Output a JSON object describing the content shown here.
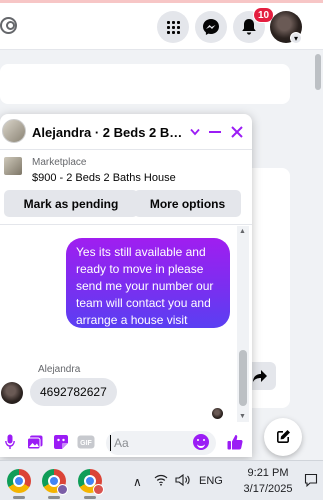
{
  "topbar": {
    "notification_count": "10"
  },
  "chat": {
    "title": "Alejandra · 2 Beds 2 Baths…",
    "marketplace_label": "Marketplace",
    "listing_title": "$900 - 2 Beds 2 Baths House",
    "mark_pending_label": "Mark as pending",
    "more_options_label": "More options",
    "outgoing_message": "Yes its still available and ready to move in please send me your number our team will contact you and arrange a house visit",
    "sender_name": "Alejandra",
    "incoming_message": "4692782627",
    "composer_placeholder": "Aa",
    "icons": [
      "caret-down-icon",
      "minimize-icon",
      "close-icon",
      "microphone-icon",
      "photo-icon",
      "sticker-icon",
      "gif-icon",
      "emoji-icon",
      "like-icon"
    ]
  },
  "taskbar": {
    "language": "ENG",
    "time": "9:21 PM",
    "date": "3/17/2025"
  },
  "colors": {
    "accent": "#9b1cf5",
    "bubble_gradient_start": "#a01ef0",
    "bubble_gradient_end": "#5a3ff2",
    "badge": "#e41e3f"
  }
}
